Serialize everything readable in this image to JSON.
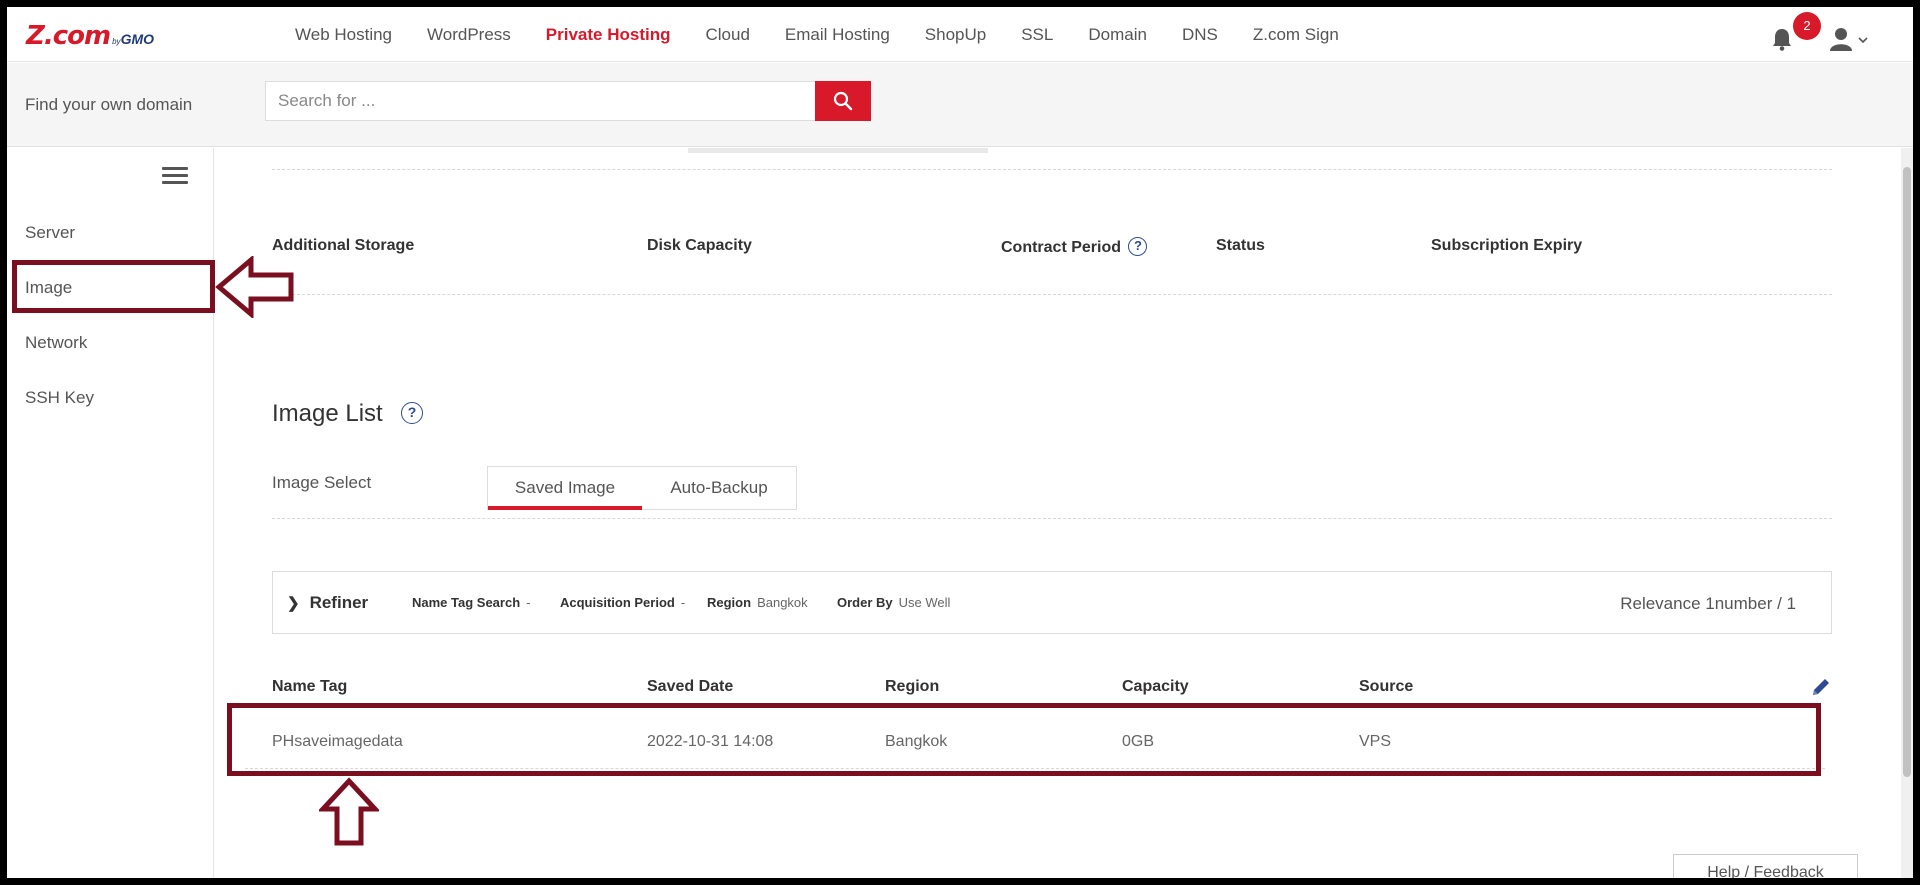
{
  "brand": {
    "logo_main": "Z.com",
    "logo_by": "by",
    "logo_gmo": "GMO"
  },
  "nav": {
    "items": [
      {
        "label": "Web Hosting",
        "active": false
      },
      {
        "label": "WordPress",
        "active": false
      },
      {
        "label": "Private Hosting",
        "active": true
      },
      {
        "label": "Cloud",
        "active": false
      },
      {
        "label": "Email Hosting",
        "active": false
      },
      {
        "label": "ShopUp",
        "active": false
      },
      {
        "label": "SSL",
        "active": false
      },
      {
        "label": "Domain",
        "active": false
      },
      {
        "label": "DNS",
        "active": false
      },
      {
        "label": "Z.com Sign",
        "active": false
      }
    ],
    "notification_count": "2",
    "icons": [
      "bell-icon",
      "user-icon",
      "chevron-down-icon"
    ]
  },
  "domain_search": {
    "label": "Find your own domain",
    "placeholder": "Search for ...",
    "icon": "search-icon"
  },
  "sidebar": {
    "items": [
      {
        "label": "Server"
      },
      {
        "label": "Image"
      },
      {
        "label": "Network"
      },
      {
        "label": "SSH Key"
      }
    ]
  },
  "storage_table": {
    "headers": [
      "Additional Storage",
      "Disk Capacity",
      "Contract Period",
      "Status",
      "Subscription Expiry"
    ],
    "help_mark": "?"
  },
  "image_list": {
    "title": "Image List",
    "help_mark": "?",
    "select_label": "Image Select",
    "tabs": [
      {
        "label": "Saved Image",
        "active": true
      },
      {
        "label": "Auto-Backup",
        "active": false
      }
    ],
    "refiner": {
      "label": "Refiner",
      "filters": [
        {
          "name": "Name Tag Search",
          "value": "-"
        },
        {
          "name": "Acquisition Period",
          "value": "-"
        },
        {
          "name": "Region",
          "value": "Bangkok"
        },
        {
          "name": "Order By",
          "value": "Use Well"
        }
      ],
      "relevance": "Relevance 1number / 1"
    },
    "columns": [
      "Name Tag",
      "Saved Date",
      "Region",
      "Capacity",
      "Source"
    ],
    "rows": [
      {
        "name_tag": "PHsaveimagedata",
        "saved_date": "2022-10-31 14:08",
        "region": "Bangkok",
        "capacity": "0GB",
        "source": "VPS"
      }
    ]
  },
  "footer": {
    "help_feedback": "Help / Feedback"
  },
  "colors": {
    "brand_red": "#d7192a",
    "annotation": "#7b0f1f",
    "help_blue": "#2e4a92"
  }
}
